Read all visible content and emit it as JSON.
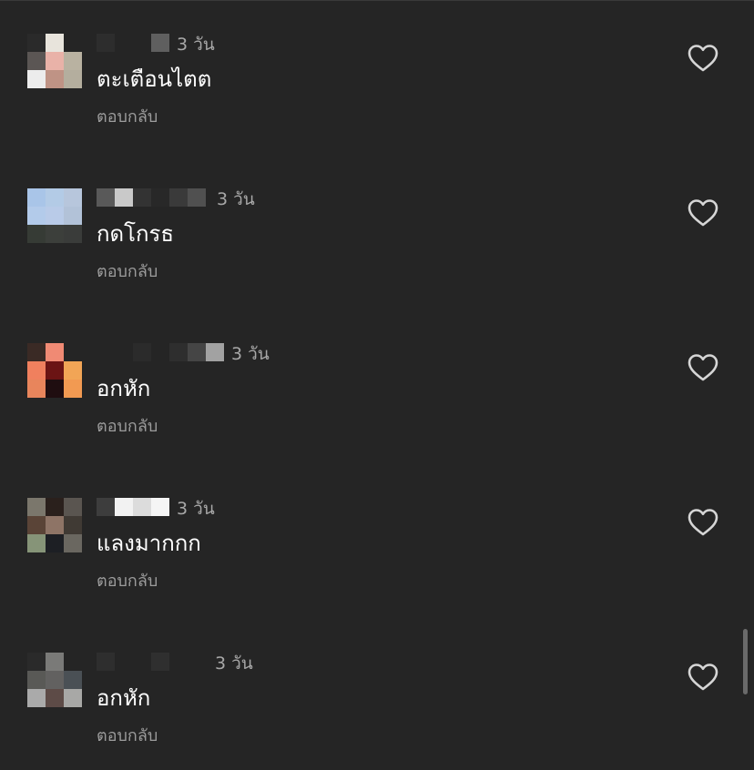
{
  "comments": [
    {
      "text": "ตะเตือนไตต",
      "time": "3 วัน",
      "reply_label": "ตอบกลับ",
      "avatar_colors": [
        "#2a2a2a",
        "#e8e4dc",
        "#252525",
        "#5b5654",
        "#e9b2a8",
        "#b9b2a1",
        "#ececec",
        "#bf9385",
        "#b4ae9e"
      ],
      "name_blocks": [
        {
          "w": 20,
          "color": "#2d2d2d"
        },
        {
          "w": 40,
          "color": "#252525"
        },
        {
          "w": 20,
          "color": "#5f5f5f"
        }
      ]
    },
    {
      "text": "กดโกรธ",
      "time": "3 วัน",
      "reply_label": "ตอบกลับ",
      "avatar_colors": [
        "#a9c5e8",
        "#b3cbe6",
        "#b7c6dc",
        "#b3cbea",
        "#b9cbe8",
        "#b2c2d8",
        "#363b35",
        "#3c3f3b",
        "#3a3c3a"
      ],
      "name_blocks": [
        {
          "w": 20,
          "color": "#595959"
        },
        {
          "w": 20,
          "color": "#c9c9c9"
        },
        {
          "w": 20,
          "color": "#333333"
        },
        {
          "w": 20,
          "color": "#282828"
        },
        {
          "w": 20,
          "color": "#3a3a3a"
        },
        {
          "w": 20,
          "color": "#505050"
        },
        {
          "w": 4,
          "color": "#252525"
        }
      ]
    },
    {
      "text": "อกหัก",
      "time": "3 วัน",
      "reply_label": "ตอบกลับ",
      "avatar_colors": [
        "#3a2a25",
        "#f08a74",
        "#252525",
        "#f0805e",
        "#6b1414",
        "#f2a556",
        "#e8855c",
        "#1f0d10",
        "#f29a52"
      ],
      "name_blocks": [
        {
          "w": 40,
          "color": "#252525"
        },
        {
          "w": 20,
          "color": "#2b2b2b"
        },
        {
          "w": 20,
          "color": "#252525"
        },
        {
          "w": 20,
          "color": "#2e2e2e"
        },
        {
          "w": 20,
          "color": "#454545"
        },
        {
          "w": 20,
          "color": "#a2a2a2"
        }
      ]
    },
    {
      "text": "แลงมากกก",
      "time": "3 วัน",
      "reply_label": "ตอบกลับ",
      "avatar_colors": [
        "#7b776c",
        "#2a201c",
        "#5a5550",
        "#5a4437",
        "#8e7466",
        "#403a34",
        "#869478",
        "#1d1f24",
        "#6a6760"
      ],
      "name_blocks": [
        {
          "w": 20,
          "color": "#3d3d3d"
        },
        {
          "w": 20,
          "color": "#f2f2f2"
        },
        {
          "w": 20,
          "color": "#dcdcdc"
        },
        {
          "w": 20,
          "color": "#f5f5f5"
        }
      ]
    },
    {
      "text": "อกหัก",
      "time": "3 วัน",
      "reply_label": "ตอบกลับ",
      "avatar_colors": [
        "#2a2a2a",
        "#7a7a78",
        "#252525",
        "#595956",
        "#626160",
        "#4a5055",
        "#aaaaaa",
        "#5d4b47",
        "#a8a8a6"
      ],
      "name_blocks": [
        {
          "w": 20,
          "color": "#2e2e2e"
        },
        {
          "w": 40,
          "color": "#252525"
        },
        {
          "w": 20,
          "color": "#2f2f2f"
        },
        {
          "w": 40,
          "color": "#252525"
        },
        {
          "w": 2,
          "color": "#252525"
        }
      ]
    }
  ],
  "heart_icon": "heart-outline-icon",
  "colors": {
    "background": "#252525",
    "comment_text": "#ffffff",
    "time_text": "#a8a8a8",
    "reply_text": "#9c9c9c",
    "heart_stroke": "#d6d6d6"
  }
}
